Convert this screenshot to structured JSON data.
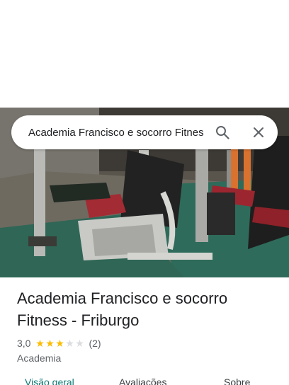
{
  "search": {
    "value": "Academia Francisco e socorro Fitness - Friburgo"
  },
  "place": {
    "title": "Academia Francisco e socorro Fitness - Friburgo",
    "rating_value": "3,0",
    "rating": 3,
    "rating_max": 5,
    "review_count": "(2)",
    "category": "Academia"
  },
  "tabs": [
    {
      "label": "Visão geral",
      "active": true
    },
    {
      "label": "Avaliações",
      "active": false
    },
    {
      "label": "Sobre",
      "active": false
    }
  ],
  "colors": {
    "star": "#fbbc04",
    "accent": "#0b7a75"
  }
}
